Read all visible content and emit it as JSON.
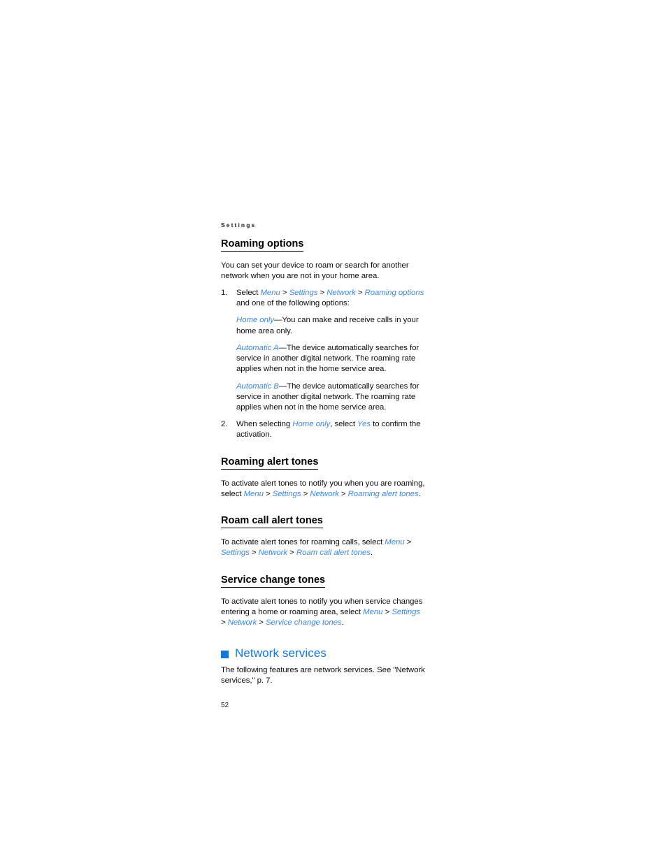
{
  "page": {
    "running_header": "Settings",
    "folio": "52",
    "accent_blue": "#1577dc",
    "reference_blue": "#3a87e0",
    "body_color": "#0d0d0d"
  },
  "sections": {
    "roaming_options": {
      "heading": "Roaming options",
      "intro": "You can set your device to roam or search for another network when you are not in your home area.",
      "steps": [
        {
          "number": "1.",
          "lead": "Select ",
          "path": [
            "Menu",
            "Settings",
            "Network",
            "Roaming options"
          ],
          "tail": " and one of the following options:"
        },
        {
          "number": "2.",
          "lead": "When selecting ",
          "term": "Home only",
          "mid": ", select ",
          "term2": "Yes",
          "tail": " to confirm the activation."
        }
      ],
      "options": [
        {
          "term": "Home only",
          "dash": "—",
          "text": "You can make and receive calls in your home area only."
        },
        {
          "term": "Automatic A",
          "dash": "—",
          "text": "The device automatically searches for service in another digital network. The roaming rate applies when not in the home service area."
        },
        {
          "term": "Automatic B",
          "dash": "—",
          "text": "The device automatically searches for service in another digital network. The roaming rate applies when not in the home service area."
        }
      ]
    },
    "roaming_alert_tones": {
      "heading": "Roaming alert tones",
      "lead": "To activate alert tones to notify you when you are roaming, select ",
      "path": [
        "Menu",
        "Settings",
        "Network",
        "Roaming alert tones"
      ],
      "tail": "."
    },
    "roam_call_alert_tones": {
      "heading": "Roam call alert tones",
      "lead": "To activate alert tones for roaming calls, select ",
      "path": [
        "Menu",
        "Settings",
        "Network",
        "Roam call alert tones"
      ],
      "tail": "."
    },
    "service_change_tones": {
      "heading": "Service change tones",
      "lead": "To activate alert tones to notify you when service changes entering a home or roaming area, select ",
      "path": [
        "Menu",
        "Settings",
        "Network",
        "Service change tones"
      ],
      "tail": "."
    },
    "network_services": {
      "heading": "Network services",
      "bullet_icon": "blue-square-bullet-icon",
      "body": "The following features are network services. See \"Network services,\" p. 7."
    }
  },
  "separators": {
    "gt": " > "
  }
}
